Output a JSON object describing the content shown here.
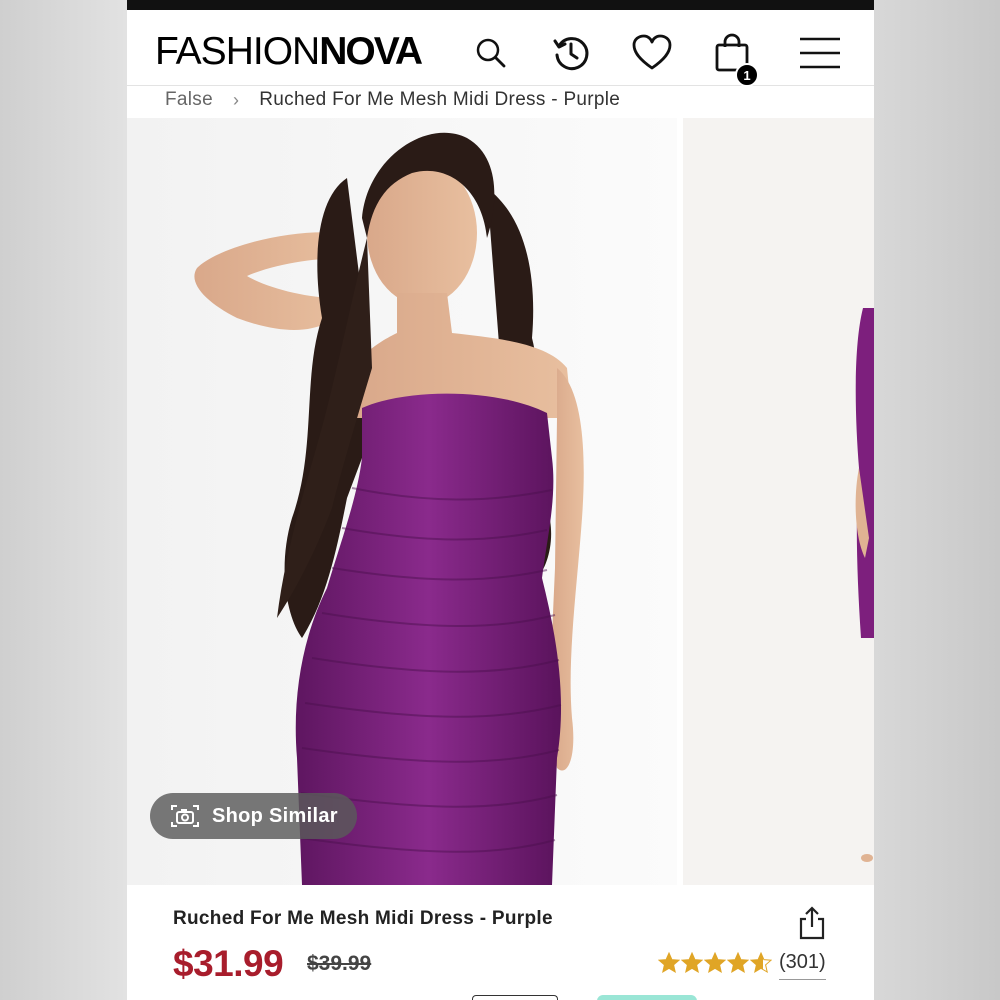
{
  "header": {
    "logo_part1": "FASHION",
    "logo_part2": "NOVA",
    "cart_count": "1"
  },
  "breadcrumb": {
    "home": "False",
    "separator": "›",
    "current": "Ruched For Me Mesh Midi Dress - Purple"
  },
  "gallery": {
    "shop_similar_label": "Shop Similar"
  },
  "product": {
    "title": "Ruched For Me Mesh Midi Dress - Purple",
    "price": "$31.99",
    "original_price": "$39.99",
    "rating": 4.6,
    "review_count": "(301)"
  },
  "colors": {
    "price_red": "#a81d2c",
    "star_gold": "#e0a526",
    "dress_purple": "#7d1f7d"
  }
}
